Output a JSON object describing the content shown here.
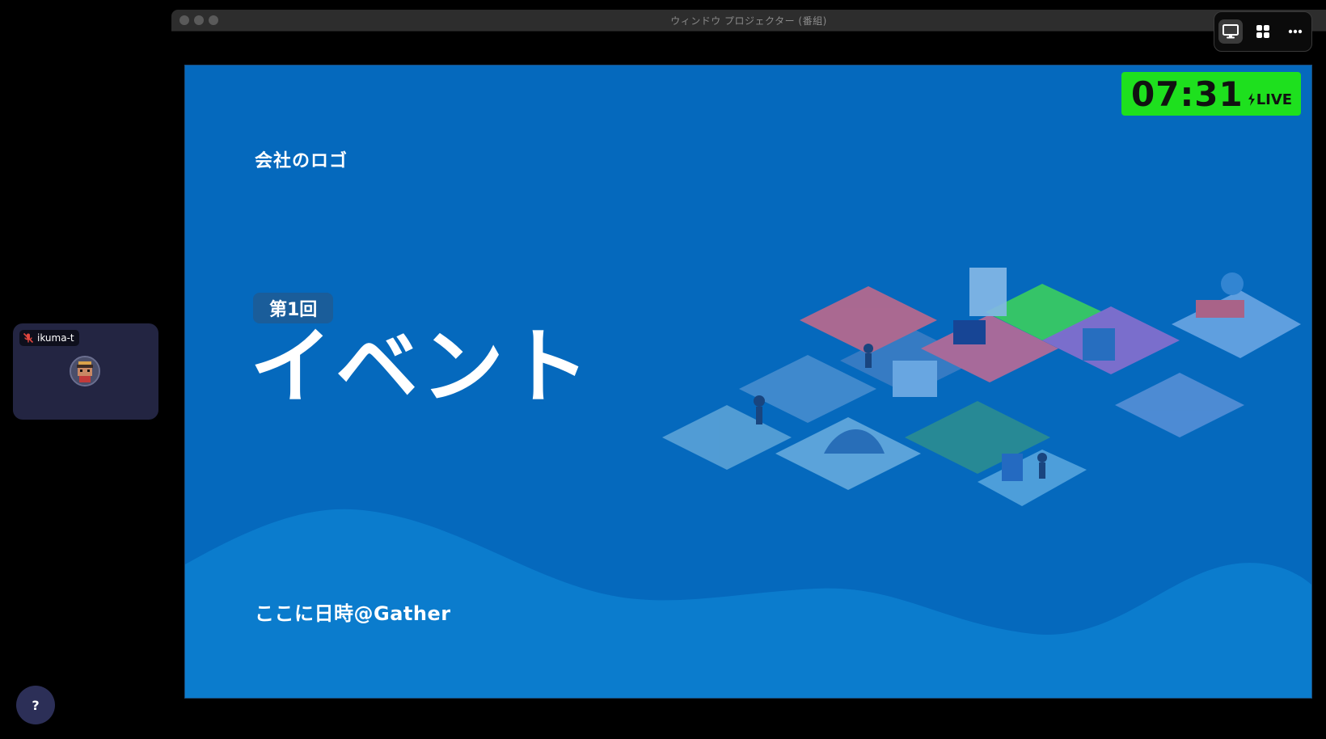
{
  "window": {
    "title": "ウィンドウ プロジェクター (番組)"
  },
  "view_controls": {
    "items": [
      {
        "icon": "monitor-icon",
        "active": true
      },
      {
        "icon": "grid-icon",
        "active": false
      },
      {
        "icon": "more-icon",
        "active": false
      }
    ]
  },
  "slide": {
    "logo_text": "会社のロゴ",
    "edition": "第1回",
    "title": "イベント",
    "date_text": "ここに日時@Gather",
    "background_color": "#0569bd"
  },
  "timer": {
    "time": "07:31",
    "live_label": "LIVE",
    "color": "#1ee01e"
  },
  "participant": {
    "name": "ikuma-t",
    "muted": true
  },
  "help": {
    "label": "?"
  }
}
